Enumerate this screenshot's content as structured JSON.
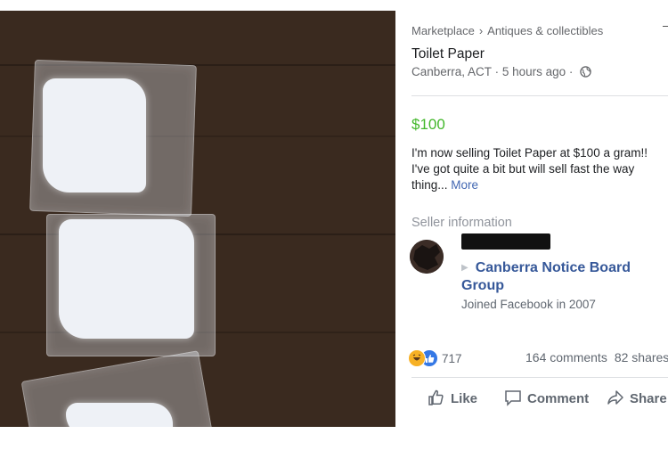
{
  "breadcrumb": {
    "root": "Marketplace",
    "separator": "›",
    "category": "Antiques & collectibles"
  },
  "listing": {
    "title": "Toilet Paper",
    "location": "Canberra, ACT",
    "time": "5 hours ago",
    "dot": "·",
    "price": "$100",
    "description": "I'm now selling Toilet Paper at $100 a gram!! I've got quite a bit but will sell fast the way thing...",
    "more_label": "More"
  },
  "seller": {
    "heading": "Seller information",
    "name": "Canberra Notice Board Group",
    "joined": "Joined Facebook in 2007"
  },
  "engagement": {
    "reactions": "717",
    "comments": "164 comments",
    "shares": "82 shares"
  },
  "actions": {
    "like": "Like",
    "comment": "Comment",
    "share": "Share"
  },
  "colors": {
    "price": "#42b72a",
    "link": "#365899",
    "muted": "#65676b"
  },
  "icons": {
    "reaction_1": "haha-icon",
    "reaction_2": "like-reaction-icon",
    "privacy": "globe-icon"
  }
}
